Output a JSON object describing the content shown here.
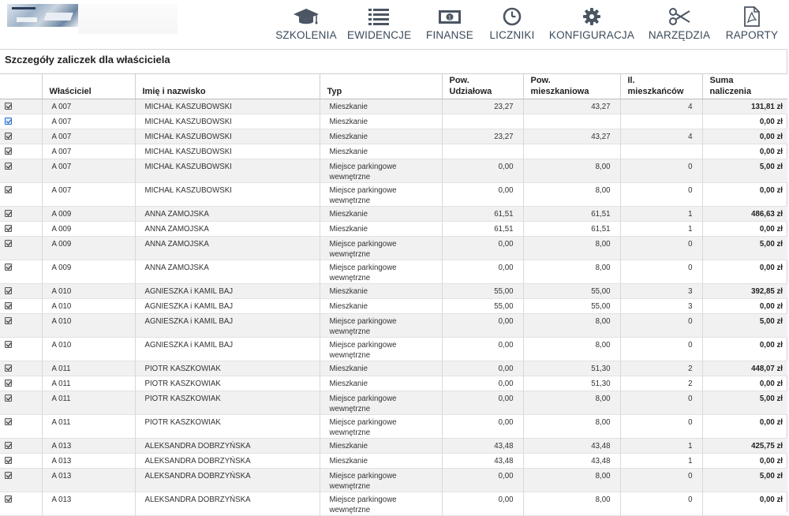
{
  "nav": [
    {
      "label": "SZKOLENIA",
      "icon": "graduation-cap-icon"
    },
    {
      "label": "EWIDENCJE",
      "icon": "list-icon"
    },
    {
      "label": "FINANSE",
      "icon": "banknote-icon"
    },
    {
      "label": "LICZNIKI",
      "icon": "clock-icon"
    },
    {
      "label": "KONFIGURACJA",
      "icon": "gear-icon"
    },
    {
      "label": "NARZĘDZIA",
      "icon": "scissors-icon"
    },
    {
      "label": "RAPORTY",
      "icon": "pdf-document-icon"
    }
  ],
  "panel": {
    "title": "Szczegóły zaliczek dla właściciela"
  },
  "columns": {
    "owner": "Właściciel",
    "name": "Imię i nazwisko",
    "type": "Typ",
    "share_area_1": "Pow.",
    "share_area_2": "Udziałowa",
    "living_area_1": "Pow.",
    "living_area_2": "mieszkaniowa",
    "residents_1": "Il.",
    "residents_2": "mieszkańców",
    "total_1": "Suma",
    "total_2": "naliczenia"
  },
  "rows": [
    {
      "owner": "A 007",
      "name": "MICHAŁ KASZUBOWSKI",
      "type": "Mieszkanie",
      "share": "23,27",
      "living": "43,27",
      "residents": "4",
      "total": "131,81 zł"
    },
    {
      "owner": "A 007",
      "name": "MICHAŁ KASZUBOWSKI",
      "type": "Mieszkanie",
      "share": "",
      "living": "",
      "residents": "",
      "total": "0,00 zł"
    },
    {
      "owner": "A 007",
      "name": "MICHAŁ KASZUBOWSKI",
      "type": "Mieszkanie",
      "share": "23,27",
      "living": "43,27",
      "residents": "4",
      "total": "0,00 zł"
    },
    {
      "owner": "A 007",
      "name": "MICHAŁ KASZUBOWSKI",
      "type": "Mieszkanie",
      "share": "",
      "living": "",
      "residents": "",
      "total": "0,00 zł"
    },
    {
      "owner": "A 007",
      "name": "MICHAŁ KASZUBOWSKI",
      "type": "Miejsce parkingowe wewnętrzne",
      "share": "0,00",
      "living": "8,00",
      "residents": "0",
      "total": "5,00 zł"
    },
    {
      "owner": "A 007",
      "name": "MICHAŁ KASZUBOWSKI",
      "type": "Miejsce parkingowe wewnętrzne",
      "share": "0,00",
      "living": "8,00",
      "residents": "0",
      "total": "0,00 zł"
    },
    {
      "owner": "A 009",
      "name": "ANNA ZAMOJSKA",
      "type": "Mieszkanie",
      "share": "61,51",
      "living": "61,51",
      "residents": "1",
      "total": "486,63 zł"
    },
    {
      "owner": "A 009",
      "name": "ANNA ZAMOJSKA",
      "type": "Mieszkanie",
      "share": "61,51",
      "living": "61,51",
      "residents": "1",
      "total": "0,00 zł"
    },
    {
      "owner": "A 009",
      "name": "ANNA ZAMOJSKA",
      "type": "Miejsce parkingowe wewnętrzne",
      "share": "0,00",
      "living": "8,00",
      "residents": "0",
      "total": "5,00 zł"
    },
    {
      "owner": "A 009",
      "name": "ANNA ZAMOJSKA",
      "type": "Miejsce parkingowe wewnętrzne",
      "share": "0,00",
      "living": "8,00",
      "residents": "0",
      "total": "0,00 zł"
    },
    {
      "owner": "A 010",
      "name": "AGNIESZKA i KAMIL BAJ",
      "type": "Mieszkanie",
      "share": "55,00",
      "living": "55,00",
      "residents": "3",
      "total": "392,85 zł"
    },
    {
      "owner": "A 010",
      "name": "AGNIESZKA i KAMIL BAJ",
      "type": "Mieszkanie",
      "share": "55,00",
      "living": "55,00",
      "residents": "3",
      "total": "0,00 zł"
    },
    {
      "owner": "A 010",
      "name": "AGNIESZKA i KAMIL BAJ",
      "type": "Miejsce parkingowe wewnętrzne",
      "share": "0,00",
      "living": "8,00",
      "residents": "0",
      "total": "5,00 zł"
    },
    {
      "owner": "A 010",
      "name": "AGNIESZKA i KAMIL BAJ",
      "type": "Miejsce parkingowe wewnętrzne",
      "share": "0,00",
      "living": "8,00",
      "residents": "0",
      "total": "0,00 zł"
    },
    {
      "owner": "A 011",
      "name": "PIOTR KASZKOWIAK",
      "type": "Mieszkanie",
      "share": "0,00",
      "living": "51,30",
      "residents": "2",
      "total": "448,07 zł"
    },
    {
      "owner": "A 011",
      "name": "PIOTR KASZKOWIAK",
      "type": "Mieszkanie",
      "share": "0,00",
      "living": "51,30",
      "residents": "2",
      "total": "0,00 zł"
    },
    {
      "owner": "A 011",
      "name": "PIOTR KASZKOWIAK",
      "type": "Miejsce parkingowe wewnętrzne",
      "share": "0,00",
      "living": "8,00",
      "residents": "0",
      "total": "5,00 zł"
    },
    {
      "owner": "A 011",
      "name": "PIOTR KASZKOWIAK",
      "type": "Miejsce parkingowe wewnętrzne",
      "share": "0,00",
      "living": "8,00",
      "residents": "0",
      "total": "0,00 zł"
    },
    {
      "owner": "A 013",
      "name": "ALEKSANDRA DOBRZYŃSKA",
      "type": "Mieszkanie",
      "share": "43,48",
      "living": "43,48",
      "residents": "1",
      "total": "425,75 zł"
    },
    {
      "owner": "A 013",
      "name": "ALEKSANDRA DOBRZYŃSKA",
      "type": "Mieszkanie",
      "share": "43,48",
      "living": "43,48",
      "residents": "1",
      "total": "0,00 zł"
    },
    {
      "owner": "A 013",
      "name": "ALEKSANDRA DOBRZYŃSKA",
      "type": "Miejsce parkingowe wewnętrzne",
      "share": "0,00",
      "living": "8,00",
      "residents": "0",
      "total": "5,00 zł"
    },
    {
      "owner": "A 013",
      "name": "ALEKSANDRA DOBRZYŃSKA",
      "type": "Miejsce parkingowe wewnętrzne",
      "share": "0,00",
      "living": "8,00",
      "residents": "0",
      "total": "0,00 zł"
    }
  ]
}
